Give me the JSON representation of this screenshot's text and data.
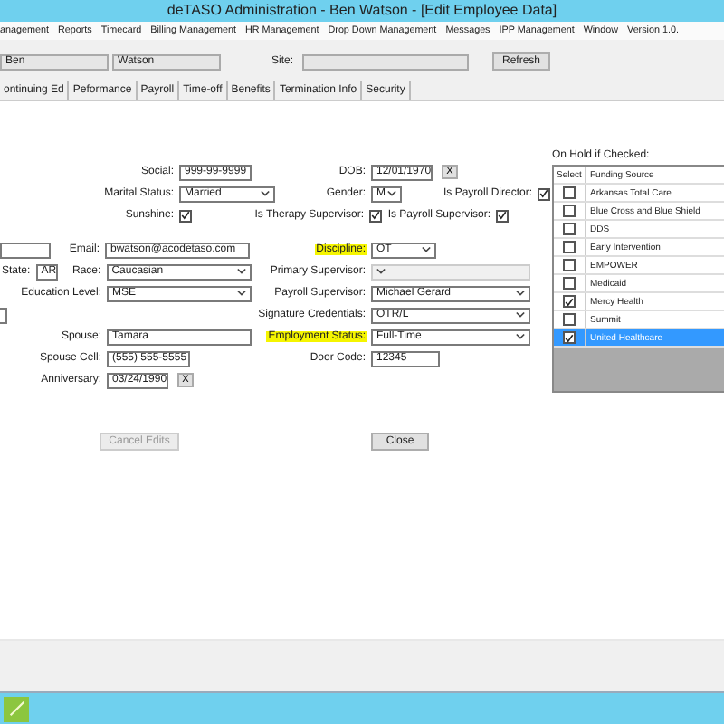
{
  "window": {
    "title": "deTASO Administration - Ben Watson - [Edit Employee Data]"
  },
  "menu": [
    "anagement",
    "Reports",
    "Timecard",
    "Billing Management",
    "HR Management",
    "Drop Down Management",
    "Messages",
    "IPP Management",
    "Window",
    "Version 1.0."
  ],
  "header": {
    "first_name": "Ben",
    "last_name": "Watson",
    "site_label": "Site:",
    "refresh": "Refresh"
  },
  "tabs": [
    "ontinuing Ed",
    "Peformance",
    "Payroll",
    "Time-off",
    "Benefits",
    "Termination Info",
    "Security"
  ],
  "personal": {
    "social": {
      "label": "Social:",
      "value": "999-99-9999"
    },
    "marital": {
      "label": "Marital Status:",
      "value": "Married"
    },
    "sunshine": {
      "label": "Sunshine:",
      "checked": true
    },
    "email": {
      "label": "Email:",
      "value": "bwatson@acodetaso.com"
    },
    "state": {
      "label": "State:",
      "value": "AR"
    },
    "race": {
      "label": "Race:",
      "value": "Caucasian"
    },
    "education": {
      "label": "Education Level:",
      "value": "MSE"
    },
    "spouse": {
      "label": "Spouse:",
      "value": "Tamara"
    },
    "spouse_cell": {
      "label": "Spouse Cell:",
      "value": "(555) 555-5555"
    },
    "anniversary": {
      "label": "Anniversary:",
      "value": "03/24/1990",
      "clear": "X"
    }
  },
  "employment": {
    "dob": {
      "label": "DOB:",
      "value": "12/01/1970",
      "clear": "X"
    },
    "gender": {
      "label": "Gender:",
      "value": "M"
    },
    "payroll_director": {
      "label": "Is Payroll Director:",
      "checked": true
    },
    "therapy_supervisor": {
      "label": "Is Therapy Supervisor:",
      "checked": true
    },
    "payroll_supervisor": {
      "label": "Is Payroll Supervisor:",
      "checked": true
    },
    "discipline": {
      "label": "Discipline:",
      "value": "OT",
      "highlighted": true
    },
    "primary_supervisor": {
      "label": "Primary Supervisor:",
      "disabled": true
    },
    "payroll_supervisor_name": {
      "label": "Payroll Supervisor:",
      "value": "Michael Gerard"
    },
    "signature": {
      "label": "Signature Credentials:",
      "value": "OTR/L"
    },
    "employment_status": {
      "label": "Employment Status:",
      "value": "Full-Time",
      "highlighted": true
    },
    "door_code": {
      "label": "Door Code:",
      "value": "12345"
    }
  },
  "funding": {
    "title": "On Hold if Checked:",
    "columns": [
      "Select",
      "Funding Source"
    ],
    "rows": [
      {
        "name": "Arkansas Total Care",
        "checked": false,
        "selected": false
      },
      {
        "name": "Blue Cross and Blue Shield",
        "checked": false,
        "selected": false
      },
      {
        "name": "DDS",
        "checked": false,
        "selected": false
      },
      {
        "name": "Early Intervention",
        "checked": false,
        "selected": false
      },
      {
        "name": "EMPOWER",
        "checked": false,
        "selected": false
      },
      {
        "name": "Medicaid",
        "checked": false,
        "selected": false
      },
      {
        "name": "Mercy Health",
        "checked": true,
        "selected": false
      },
      {
        "name": "Summit",
        "checked": false,
        "selected": false
      },
      {
        "name": "United Healthcare",
        "checked": true,
        "selected": true
      }
    ]
  },
  "buttons": {
    "cancel": {
      "label": "Cancel Edits",
      "disabled": true
    },
    "close": {
      "label": "Close",
      "disabled": false
    }
  }
}
